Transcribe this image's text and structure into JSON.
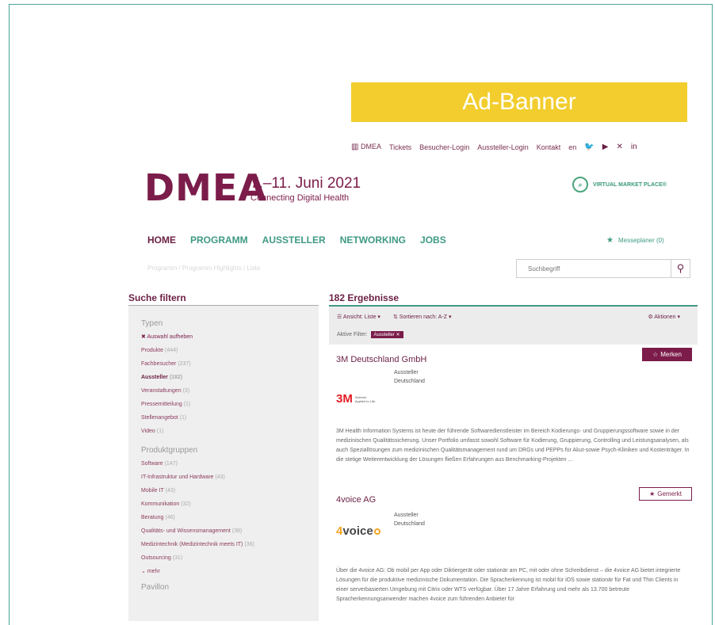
{
  "ad_banner": "Ad-Banner",
  "topnav": {
    "dmea": "DMEA",
    "tickets": "Tickets",
    "visitor_login": "Besucher-Login",
    "exhibitor_login": "Aussteller-Login",
    "contact": "Kontakt",
    "lang": "en"
  },
  "header": {
    "logo": "DMEA",
    "dates": "7.–11. Juni 2021",
    "tagline": "Connecting Digital Health",
    "vmp": "VIRTUAL MARKET PLACE®"
  },
  "mainnav": [
    "HOME",
    "PROGRAMM",
    "AUSSTELLER",
    "NETWORKING",
    "JOBS"
  ],
  "messeplaner": "Messeplaner (0)",
  "breadcrumb": "Programm / Programm Highlights / Liste",
  "search": {
    "placeholder": "Suchbegriff"
  },
  "filter": {
    "title": "Suche filtern",
    "types_title": "Typen",
    "clear": "Auswahl aufheben",
    "types": [
      {
        "label": "Produkte",
        "count": "(444)"
      },
      {
        "label": "Fachbesucher",
        "count": "(237)"
      },
      {
        "label": "Aussteller",
        "count": "(182)"
      },
      {
        "label": "Veranstaltungen",
        "count": "(3)"
      },
      {
        "label": "Pressemitteilung",
        "count": "(1)"
      },
      {
        "label": "Stellenangebot",
        "count": "(1)"
      },
      {
        "label": "Video",
        "count": "(1)"
      }
    ],
    "groups_title": "Produktgruppen",
    "groups": [
      {
        "label": "Software",
        "count": "(147)"
      },
      {
        "label": "IT-Infrastruktur und Hardware",
        "count": "(43)"
      },
      {
        "label": "Mobile IT",
        "count": "(43)"
      },
      {
        "label": "Kommunikation",
        "count": "(32)"
      },
      {
        "label": "Beratung",
        "count": "(46)"
      },
      {
        "label": "Qualitäts- und Wissensmanagement",
        "count": "(38)"
      },
      {
        "label": "Medizintechnik (Medizintechnik meets IT)",
        "count": "(36)"
      },
      {
        "label": "Outsourcing",
        "count": "(31)"
      }
    ],
    "more": "mehr",
    "pavilion_title": "Pavillon"
  },
  "results": {
    "title": "182 Ergebnisse",
    "view": "Ansicht: Liste",
    "sort": "Sortieren nach: A-Z",
    "actions": "Aktionen",
    "active_filter": "Aktive Filter:",
    "chip": "Aussteller"
  },
  "cards": [
    {
      "name": "3M Deutschland GmbH",
      "type": "Aussteller",
      "country": "Deutschland",
      "button": "Merken",
      "logo_sub1": "Science.",
      "logo_sub2": "Applied to Life.",
      "desc": "3M Health Information Systems ist heute der führende Softwaredienstleister im Bereich Kodierungs- und Gruppierungssoftware sowie in der medizinischen Qualitätssicherung. Unser Portfolio umfasst sowohl Software für Kodierung, Gruppierung, Controlling und Leistungsanalysen, als auch Speziallösungen zum medizinischen Qualitätsmanagement rund um DRGs und PEPPs für Akut-sowie Psych-Kliniken und Kostenträger. In die stetige Weiterentwicklung der Lösungen fließen Erfahrungen aus Benchmarking-Projekten ..."
    },
    {
      "name": "4voice AG",
      "type": "Aussteller",
      "country": "Deutschland",
      "button": "Gemerkt",
      "desc": "Über die 4voice AG: Ob mobil per App oder Diktiergerät oder stationär am PC, mit oder ohne Schreibdienst – die 4voice AG bietet integrierte Lösungen für die produktive medizinische Dokumentation. Die Spracherkennung ist mobil für iOS sowie stationär für Fat und Thin Clients in einer serverbasierten Umgebung mit Citrix oder WTS verfügbar. Über 17 Jahre Erfahrung und mehr als 13.700 betreute Spracherkennungsanwender machen 4voice zum führenden Anbieter für"
    }
  ],
  "colors": {
    "brand": "#7b1c4a",
    "accent": "#3f9a83",
    "banner": "#f2cd2d",
    "frame": "#4aa49a"
  }
}
